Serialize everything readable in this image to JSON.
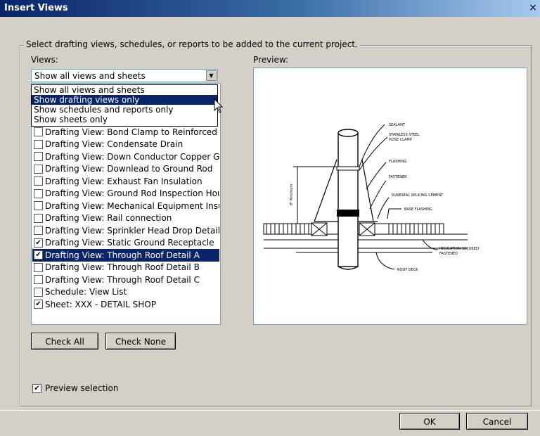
{
  "window": {
    "title": "Insert Views",
    "close_glyph": "×"
  },
  "group": {
    "legend": "Select drafting views, schedules, or reports to be added to the current project."
  },
  "views_label": "Views:",
  "preview_label": "Preview:",
  "filter": {
    "selected": "Show all views and sheets",
    "options": [
      "Show all views and sheets",
      "Show drafting views only",
      "Show schedules and reports only",
      "Show sheets only"
    ],
    "highlighted_index": 1
  },
  "views": [
    {
      "label": "Drafting View: Bond Clamp to Reinforced Concr",
      "checked": false,
      "selected": false
    },
    {
      "label": "Drafting View: Condensate Drain",
      "checked": false,
      "selected": false
    },
    {
      "label": "Drafting View: Down Conductor Copper Guard",
      "checked": false,
      "selected": false
    },
    {
      "label": "Drafting View: Downlead to Ground Rod",
      "checked": false,
      "selected": false
    },
    {
      "label": "Drafting View: Exhaust Fan Insulation",
      "checked": false,
      "selected": false
    },
    {
      "label": "Drafting View: Ground Rod Inspection Housing",
      "checked": false,
      "selected": false
    },
    {
      "label": "Drafting View: Mechanical Equipment Insulation",
      "checked": false,
      "selected": false
    },
    {
      "label": "Drafting View: Rail connection",
      "checked": false,
      "selected": false
    },
    {
      "label": "Drafting View: Sprinkler Head Drop Detail",
      "checked": false,
      "selected": false
    },
    {
      "label": "Drafting View: Static Ground Receptacle",
      "checked": true,
      "selected": false
    },
    {
      "label": "Drafting View: Through Roof Detail A",
      "checked": true,
      "selected": true
    },
    {
      "label": "Drafting View: Through Roof Detail B",
      "checked": false,
      "selected": false
    },
    {
      "label": "Drafting View: Through Roof Detail C",
      "checked": false,
      "selected": false
    },
    {
      "label": "Schedule: View List",
      "checked": false,
      "selected": false
    },
    {
      "label": "Sheet: XXX - DETAIL SHOP",
      "checked": true,
      "selected": false
    }
  ],
  "buttons": {
    "check_all": "Check All",
    "check_none": "Check None",
    "ok": "OK",
    "cancel": "Cancel"
  },
  "preview_selection": {
    "label": "Preview selection",
    "checked": true
  },
  "preview_drawing": {
    "labels": {
      "sealant": "SEALANT",
      "clamp_1": "STAINLESS STEEL",
      "clamp_2": "HOSE CLAMP",
      "flashing": "FLASHING",
      "fastener": "FASTENER",
      "cement": "SURESEAL SPLICING CEMENT",
      "base_flashing": "BASE FLASHING",
      "insulation_1": "INSULATION SECURELY",
      "insulation_2": "FASTENED",
      "roof_deck": "ROOF DECK",
      "dimension": "8\" Minimum"
    }
  }
}
